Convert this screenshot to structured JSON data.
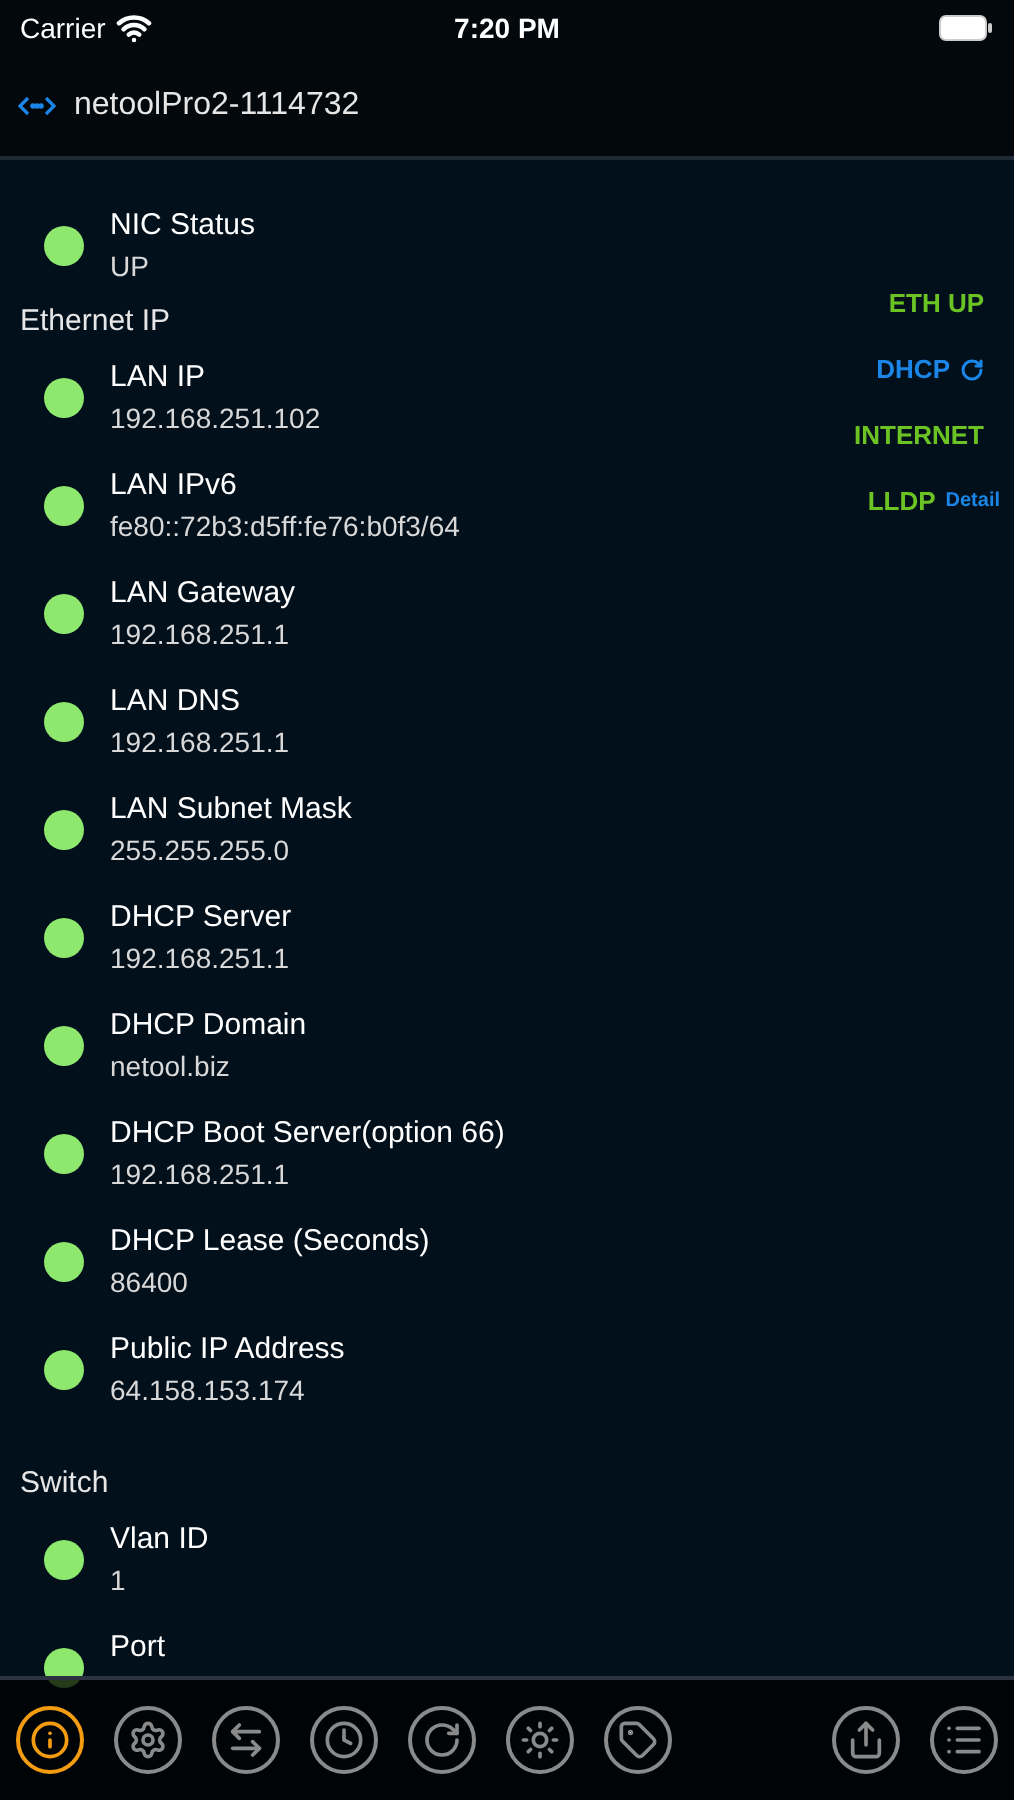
{
  "status_bar": {
    "carrier": "Carrier",
    "time": "7:20 PM"
  },
  "nav": {
    "title": "netoolPro2-1114732"
  },
  "sections": [
    {
      "items": [
        {
          "title": "NIC Status",
          "value": "UP",
          "color": "#8ee86e"
        }
      ]
    },
    {
      "header": "Ethernet IP",
      "items": [
        {
          "title": "LAN IP",
          "value": "192.168.251.102",
          "color": "#8ee86e"
        },
        {
          "title": "LAN IPv6",
          "value": "fe80::72b3:d5ff:fe76:b0f3/64",
          "color": "#8ee86e"
        },
        {
          "title": "LAN Gateway",
          "value": "192.168.251.1",
          "color": "#8ee86e"
        },
        {
          "title": "LAN DNS",
          "value": "192.168.251.1",
          "color": "#8ee86e"
        },
        {
          "title": "LAN Subnet Mask",
          "value": "255.255.255.0",
          "color": "#8ee86e"
        },
        {
          "title": "DHCP Server",
          "value": "192.168.251.1",
          "color": "#8ee86e"
        },
        {
          "title": "DHCP Domain",
          "value": "netool.biz",
          "color": "#8ee86e"
        },
        {
          "title": "DHCP Boot Server(option 66)",
          "value": "192.168.251.1",
          "color": "#8ee86e"
        },
        {
          "title": "DHCP Lease (Seconds)",
          "value": "86400",
          "color": "#8ee86e"
        },
        {
          "title": "Public IP Address",
          "value": "64.158.153.174",
          "color": "#8ee86e"
        }
      ]
    },
    {
      "header": "Switch",
      "items": [
        {
          "title": "Vlan ID",
          "value": "1",
          "color": "#8ee86e"
        },
        {
          "title": "Port",
          "color": "#8ee86e"
        }
      ]
    }
  ],
  "indicators": [
    {
      "label": "ETH UP",
      "color": "#6cc424",
      "kind": "plain"
    },
    {
      "label": "DHCP",
      "color": "#1a86e8",
      "kind": "refresh"
    },
    {
      "label": "INTERNET",
      "color": "#6cc424",
      "kind": "plain"
    },
    {
      "label": "LLDP",
      "color": "#6cc424",
      "kind": "detail",
      "link": "Detail"
    }
  ],
  "toolbar": [
    {
      "kind": "info",
      "selected": true
    },
    {
      "kind": "settings",
      "selected": false
    },
    {
      "kind": "swap",
      "selected": false
    },
    {
      "kind": "clock",
      "selected": false
    },
    {
      "kind": "refresh",
      "selected": false
    },
    {
      "kind": "light",
      "selected": false
    },
    {
      "kind": "tag",
      "selected": false
    },
    {
      "kind": "spacer"
    },
    {
      "kind": "share",
      "selected": false
    },
    {
      "kind": "list",
      "selected": false
    }
  ]
}
